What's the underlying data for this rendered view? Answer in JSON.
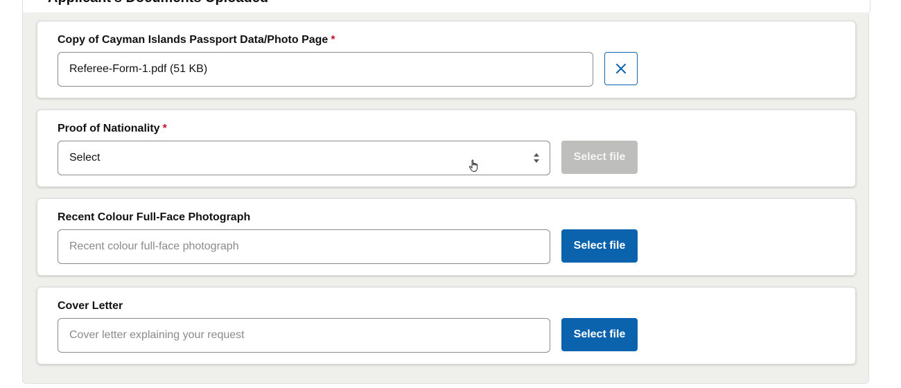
{
  "section": {
    "title": "Applicant's Documents Uploaded"
  },
  "cards": [
    {
      "label": "Copy of Cayman Islands Passport Data/Photo Page",
      "required": true,
      "required_mark": "*",
      "value": "Referee-Form-1.pdf (51 KB)",
      "action_icon": "close-icon"
    },
    {
      "label": "Proof of Nationality",
      "required": true,
      "required_mark": "*",
      "select_value": "Select",
      "button_label": "Select file",
      "button_state": "disabled"
    },
    {
      "label": "Recent Colour Full-Face Photograph",
      "required": false,
      "placeholder": "Recent colour full-face photograph",
      "button_label": "Select file"
    },
    {
      "label": "Cover Letter",
      "required": false,
      "placeholder": "Cover letter explaining your request",
      "button_label": "Select file"
    }
  ],
  "colors": {
    "primary": "#0b62ad",
    "required": "#c8102e",
    "disabled": "#bebebc",
    "panel_bg": "#efefeb"
  }
}
